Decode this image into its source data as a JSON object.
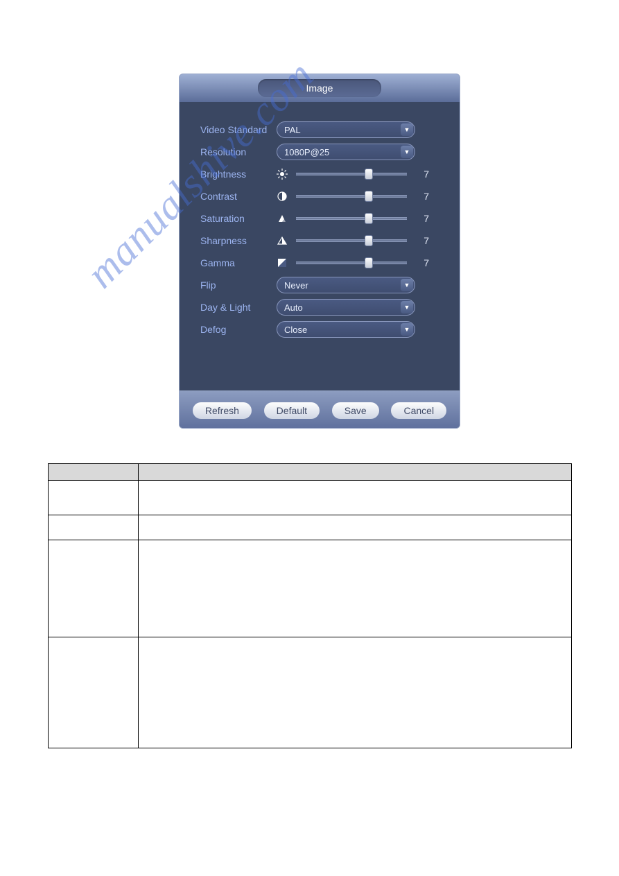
{
  "panel": {
    "title": "Image",
    "fields": {
      "video_standard": {
        "label": "Video Standard",
        "value": "PAL"
      },
      "resolution": {
        "label": "Resolution",
        "value": "1080P@25"
      },
      "brightness": {
        "label": "Brightness",
        "value": 7,
        "min": 0,
        "max": 10
      },
      "contrast": {
        "label": "Contrast",
        "value": 7,
        "min": 0,
        "max": 10
      },
      "saturation": {
        "label": "Saturation",
        "value": 7,
        "min": 0,
        "max": 10
      },
      "sharpness": {
        "label": "Sharpness",
        "value": 7,
        "min": 0,
        "max": 10
      },
      "gamma": {
        "label": "Gamma",
        "value": 7,
        "min": 0,
        "max": 10
      },
      "flip": {
        "label": "Flip",
        "value": "Never"
      },
      "day_light": {
        "label": "Day & Light",
        "value": "Auto"
      },
      "defog": {
        "label": "Defog",
        "value": "Close"
      }
    },
    "buttons": {
      "refresh": "Refresh",
      "default": "Default",
      "save": "Save",
      "cancel": "Cancel"
    }
  },
  "watermark": "manualshive.com",
  "table": {
    "headers": {
      "c1": "",
      "c2": ""
    },
    "rows": [
      {
        "c1": "",
        "c2": ""
      },
      {
        "c1": "",
        "c2": ""
      },
      {
        "c1": "",
        "c2": ""
      },
      {
        "c1": "",
        "c2": ""
      }
    ]
  }
}
